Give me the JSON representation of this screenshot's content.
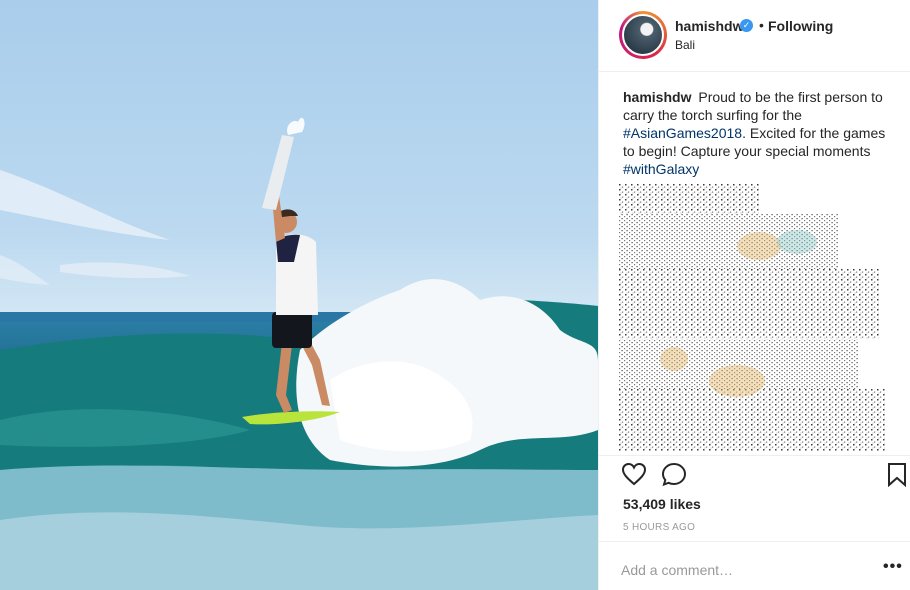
{
  "post": {
    "image_alt": "Surfer carrying a torch on a green surfboard riding a wave"
  },
  "header": {
    "username": "hamishdw",
    "verified_icon": "verified-badge-icon",
    "separator": "•",
    "follow_status": "Following",
    "location": "Bali"
  },
  "caption": {
    "username": "hamishdw",
    "text_1": "Proud to be the first person to carry the torch surfing for the",
    "hashtag_1": "#AsianGames2018",
    "text_2": ". Excited for the games to begin! Capture your special moments",
    "hashtag_2": "#withGalaxy"
  },
  "actions": {
    "like_icon": "heart-icon",
    "comment_icon": "comment-bubble-icon",
    "save_icon": "bookmark-icon"
  },
  "stats": {
    "likes": "53,409 likes",
    "time_ago": "5 HOURS AGO"
  },
  "comment": {
    "placeholder": "Add a comment…",
    "more": "•••"
  },
  "colors": {
    "link": "#003569",
    "verified": "#3897f0",
    "border": "#efefef",
    "muted": "#999999"
  }
}
